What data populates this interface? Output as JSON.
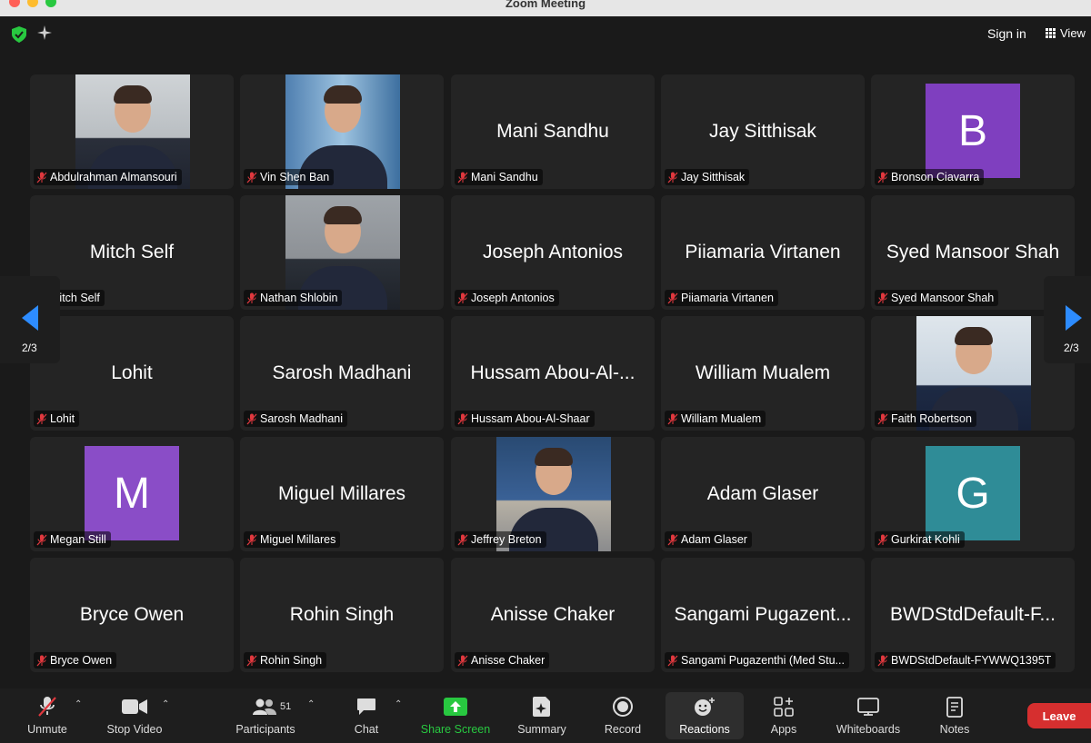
{
  "window": {
    "title": "Zoom Meeting"
  },
  "topbar": {
    "sign_in": "Sign in",
    "view": "View"
  },
  "colors": {
    "avatar_b": "#7f3fbf",
    "avatar_m": "#8a4dc7",
    "avatar_g": "#2f8c97",
    "share_green": "#28c840",
    "leave_red": "#d62f2f"
  },
  "participants": [
    {
      "big": "",
      "label": "Abdulrahman Almansouri",
      "muted": true,
      "kind": "photo"
    },
    {
      "big": "",
      "label": "Vin Shen Ban",
      "muted": true,
      "kind": "photo"
    },
    {
      "big": "Mani Sandhu",
      "label": "Mani Sandhu",
      "muted": true,
      "kind": "name"
    },
    {
      "big": "Jay Sitthisak",
      "label": "Jay Sitthisak",
      "muted": true,
      "kind": "name"
    },
    {
      "big": "B",
      "label": "Bronson Ciavarra",
      "muted": true,
      "kind": "avatar"
    },
    {
      "big": "Mitch Self",
      "label": "Mitch Self",
      "muted": true,
      "kind": "name"
    },
    {
      "big": "",
      "label": "Nathan Shlobin",
      "muted": true,
      "kind": "photo"
    },
    {
      "big": "Joseph Antonios",
      "label": "Joseph Antonios",
      "muted": true,
      "kind": "name"
    },
    {
      "big": "Piiamaria Virtanen",
      "label": "Piiamaria Virtanen",
      "muted": true,
      "kind": "name"
    },
    {
      "big": "Syed Mansoor Shah",
      "label": "Syed Mansoor Shah",
      "muted": true,
      "kind": "name"
    },
    {
      "big": "Lohit",
      "label": "Lohit",
      "muted": true,
      "kind": "name"
    },
    {
      "big": "Sarosh Madhani",
      "label": "Sarosh Madhani",
      "muted": true,
      "kind": "name"
    },
    {
      "big": "Hussam Abou-Al-...",
      "label": "Hussam Abou-Al-Shaar",
      "muted": true,
      "kind": "name"
    },
    {
      "big": "William Mualem",
      "label": "William Mualem",
      "muted": true,
      "kind": "name"
    },
    {
      "big": "",
      "label": "Faith Robertson",
      "muted": true,
      "kind": "photo"
    },
    {
      "big": "M",
      "label": "Megan Still",
      "muted": true,
      "kind": "avatar"
    },
    {
      "big": "Miguel Millares",
      "label": "Miguel Millares",
      "muted": true,
      "kind": "name"
    },
    {
      "big": "",
      "label": "Jeffrey Breton",
      "muted": true,
      "kind": "photo"
    },
    {
      "big": "Adam Glaser",
      "label": "Adam Glaser",
      "muted": true,
      "kind": "name"
    },
    {
      "big": "G",
      "label": "Gurkirat Kohli",
      "muted": true,
      "kind": "avatar"
    },
    {
      "big": "Bryce Owen",
      "label": "Bryce Owen",
      "muted": true,
      "kind": "name"
    },
    {
      "big": "Rohin Singh",
      "label": "Rohin Singh",
      "muted": true,
      "kind": "name"
    },
    {
      "big": "Anisse Chaker",
      "label": "Anisse Chaker",
      "muted": true,
      "kind": "name"
    },
    {
      "big": "Sangami Pugazent...",
      "label": "Sangami Pugazenthi (Med Stu...",
      "muted": true,
      "kind": "name"
    },
    {
      "big": "BWDStdDefault-F...",
      "label": "BWDStdDefault-FYWWQ1395T",
      "muted": true,
      "kind": "name"
    }
  ],
  "pager": {
    "left": "2/3",
    "right": "2/3"
  },
  "toolbar": {
    "unmute": "Unmute",
    "stop_video": "Stop Video",
    "participants": "Participants",
    "participants_count": "51",
    "chat": "Chat",
    "share_screen": "Share Screen",
    "summary": "Summary",
    "record": "Record",
    "reactions": "Reactions",
    "apps": "Apps",
    "whiteboards": "Whiteboards",
    "notes": "Notes",
    "leave": "Leave"
  }
}
